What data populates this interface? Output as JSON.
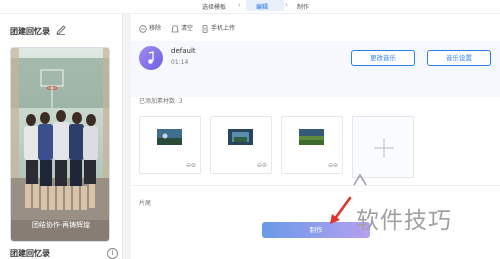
{
  "steps": [
    {
      "label": "选择模板"
    },
    {
      "label": "编辑"
    },
    {
      "label": "制作"
    }
  ],
  "left": {
    "title": "团建回忆录",
    "bottom_title": "团建回忆录",
    "caption": "团结协作·再铸辉煌",
    "info_glyph": "i"
  },
  "toolbar": {
    "remove": "移除",
    "clear": "清空",
    "phone_upload": "手机上传"
  },
  "music": {
    "name": "default",
    "duration": "01:14",
    "change_label": "更改音乐",
    "settings_label": "音乐设置"
  },
  "materials": {
    "label": "已添加素材数: 3",
    "thumb_ctrl": "⊖⊘"
  },
  "tail": {
    "label": "片尾"
  },
  "make_button": {
    "label": "制作"
  },
  "watermark": {
    "text": "软件技巧"
  }
}
